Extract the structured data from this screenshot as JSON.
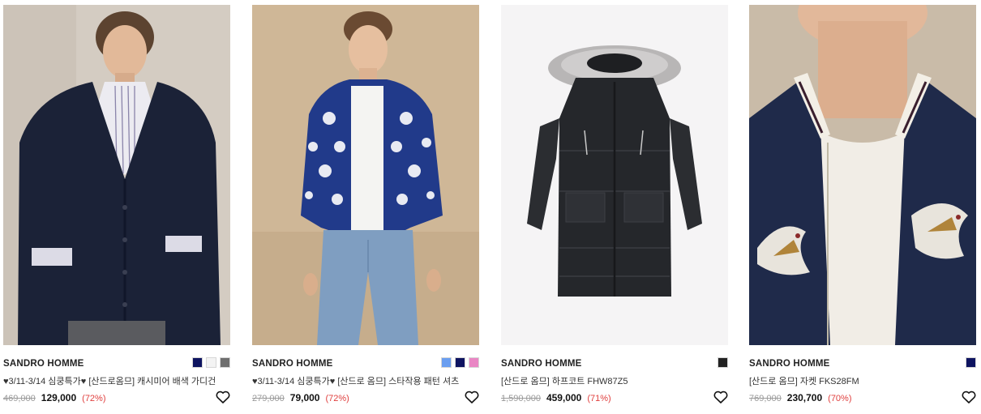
{
  "products": [
    {
      "image_alt": "SANDRO HOMME",
      "brand": "SANDRO HOMME",
      "name": "♥3/11-3/14 심쿵특가♥ [산드로옴므] 캐시미어 배색 가디건",
      "original_price": "469,000",
      "sale_price": "129,000",
      "discount": "(72%)",
      "swatches": [
        "#0e1460",
        "#f3f3f3",
        "#6e6e6e"
      ],
      "wishlist_icon": "heart-outline-icon"
    },
    {
      "image_alt": "SANDRO HOMME",
      "brand": "SANDRO HOMME",
      "name": "♥3/11-3/14 심쿵특가♥ [산드로 옴므] 스타작용 패턴 셔츠",
      "original_price": "279,000",
      "sale_price": "79,000",
      "discount": "(72%)",
      "swatches": [
        "#6a9ef0",
        "#0e1460",
        "#e986c4"
      ],
      "wishlist_icon": "heart-outline-icon"
    },
    {
      "image_alt": "SANDRO HOMME",
      "brand": "SANDRO HOMME",
      "name": "[산드로 옴므] 하프코트 FHW87Z5",
      "original_price": "1,590,000",
      "sale_price": "459,000",
      "discount": "(71%)",
      "swatches": [
        "#222222"
      ],
      "wishlist_icon": "heart-outline-icon"
    },
    {
      "image_alt": "SANDRO HOMME",
      "brand": "SANDRO HOMME",
      "name": "[산드로 옴므] 자켓 FKS28FM",
      "original_price": "769,000",
      "sale_price": "230,700",
      "discount": "(70%)",
      "swatches": [
        "#0e1460"
      ],
      "wishlist_icon": "heart-outline-icon"
    }
  ],
  "colors": {
    "sale_percent": "#e0403f",
    "original_price": "#9a9a9a",
    "text": "#222222"
  }
}
